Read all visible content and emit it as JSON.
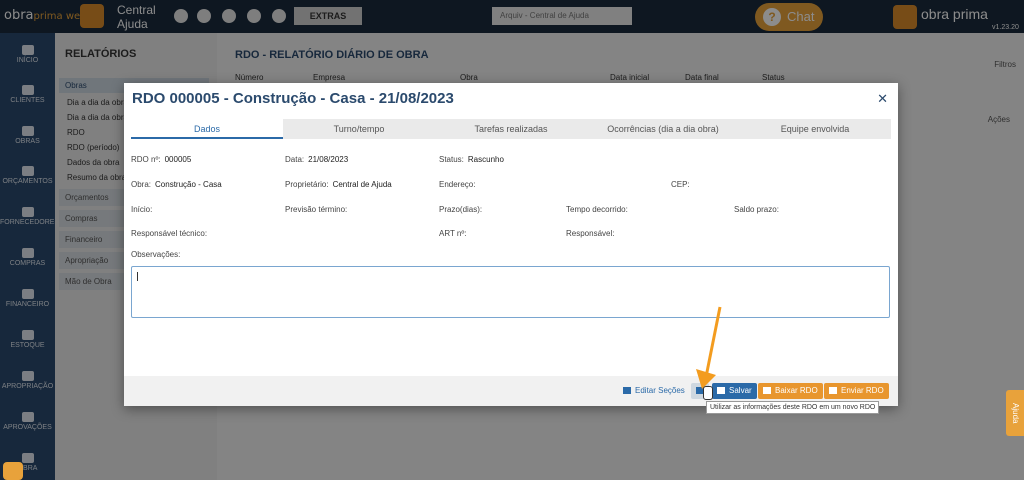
{
  "topbar": {
    "logo_text": "obra",
    "logo_accent": "prima web",
    "brand_line1": "Central",
    "brand_line2": "Ajuda",
    "extras_label": "EXTRAS",
    "select_value": "Arquiv - Central de Ajuda",
    "chat_label": "Chat",
    "brand_right": "obra prima",
    "version": "v1.23.20"
  },
  "leftnav": {
    "items": [
      "INÍCIO",
      "CLIENTES",
      "OBRAS",
      "ORÇAMENTOS",
      "FORNECEDORES",
      "COMPRAS",
      "FINANCEIRO",
      "ESTOQUE",
      "APROPRIAÇÃO",
      "APROVAÇÕES",
      "OBRA"
    ]
  },
  "subnav": {
    "title": "RELATÓRIOS",
    "section_obras": "Obras",
    "items": [
      "Dia a dia da obra",
      "Dia a dia da obra",
      "RDO",
      "RDO (período)",
      "Dados da obra",
      "Resumo da obra"
    ],
    "sections": [
      "Orçamentos",
      "Compras",
      "Financeiro",
      "Apropriação",
      "Mão de Obra"
    ]
  },
  "main": {
    "title": "RDO - RELATÓRIO DIÁRIO DE OBRA",
    "columns": [
      "Número",
      "Empresa",
      "Obra",
      "Data inicial",
      "Data final",
      "Status"
    ],
    "filters_label": "Filtros",
    "actions_label": "Ações"
  },
  "modal": {
    "title": "RDO 000005 - Construção - Casa - 21/08/2023",
    "tabs": [
      "Dados",
      "Turno/tempo",
      "Tarefas realizadas",
      "Ocorrências (dia a dia obra)",
      "Equipe envolvida"
    ],
    "fields": {
      "rdo_label": "RDO nº:",
      "rdo_value": "000005",
      "data_label": "Data:",
      "data_value": "21/08/2023",
      "status_label": "Status:",
      "status_value": "Rascunho",
      "obra_label": "Obra:",
      "obra_value": "Construção - Casa",
      "proprietario_label": "Proprietário:",
      "proprietario_value": "Central de Ajuda",
      "endereco_label": "Endereço:",
      "cep_label": "CEP:",
      "inicio_label": "Início:",
      "previsao_label": "Previsão término:",
      "prazo_label": "Prazo(dias):",
      "tempo_label": "Tempo decorrido:",
      "saldo_label": "Saldo prazo:",
      "resp_tec_label": "Responsável técnico:",
      "art_label": "ART nº:",
      "responsavel_label": "Responsável:",
      "obs_label": "Observações:"
    },
    "buttons": {
      "edit": "Editar Seções",
      "save": "Salvar",
      "baixar": "Baixar RDO",
      "enviar": "Enviar RDO"
    },
    "tooltip": "Utilizar as informações deste RDO em um novo RDO"
  },
  "help_label": "Ajuda",
  "colors": {
    "accent": "#e8962e",
    "primary": "#2b6aa8",
    "nav": "#2b4a6d"
  }
}
